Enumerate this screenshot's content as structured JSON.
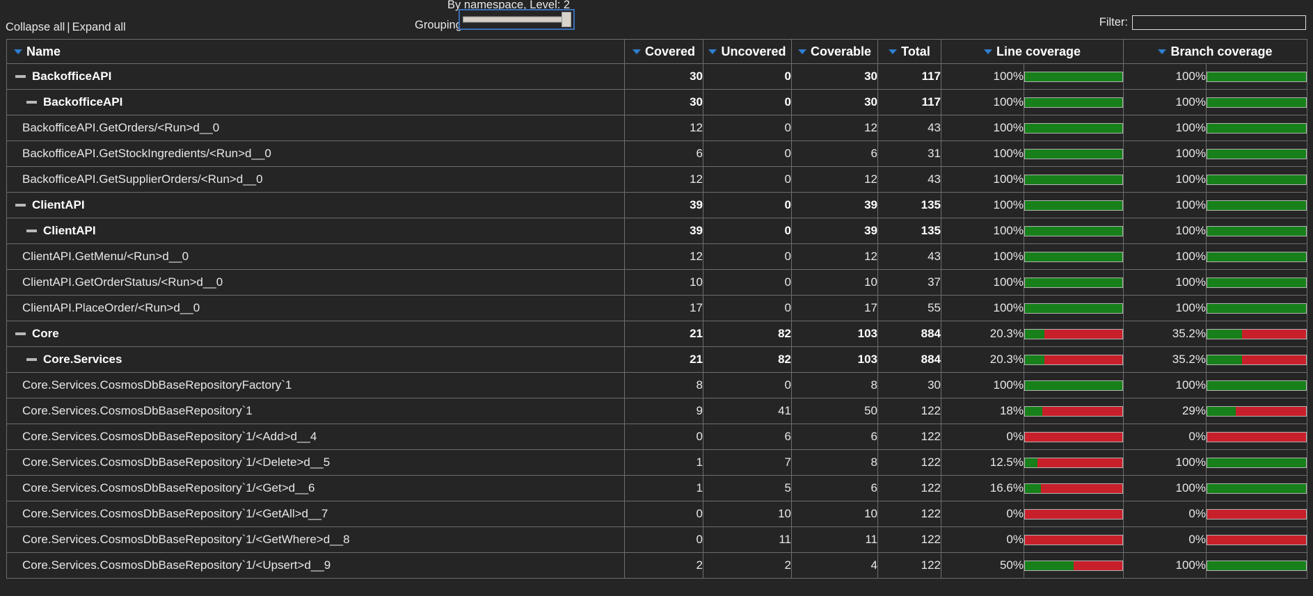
{
  "toolbar": {
    "collapse_all": "Collapse all",
    "separator": "|",
    "expand_all": "Expand all",
    "grouping_caption": "By namespace, Level: 2",
    "grouping_label": "Grouping:",
    "grouping_value": "2",
    "filter_label": "Filter:",
    "filter_value": "",
    "filter_placeholder": ""
  },
  "table": {
    "columns": [
      "Name",
      "Covered",
      "Uncovered",
      "Coverable",
      "Total",
      "Line coverage",
      "Branch coverage"
    ],
    "rows": [
      {
        "name": "BackofficeAPI",
        "level": 0,
        "bold": true,
        "expander": "minus",
        "covered": "30",
        "uncovered": "0",
        "coverable": "30",
        "total": "117",
        "line_pct": "100%",
        "line_val": 100,
        "branch_pct": "100%",
        "branch_val": 100
      },
      {
        "name": "BackofficeAPI",
        "level": 1,
        "bold": true,
        "expander": "minus",
        "covered": "30",
        "uncovered": "0",
        "coverable": "30",
        "total": "117",
        "line_pct": "100%",
        "line_val": 100,
        "branch_pct": "100%",
        "branch_val": 100
      },
      {
        "name": "BackofficeAPI.GetOrders/<Run>d__0",
        "level": 2,
        "bold": false,
        "expander": "none",
        "covered": "12",
        "uncovered": "0",
        "coverable": "12",
        "total": "43",
        "line_pct": "100%",
        "line_val": 100,
        "branch_pct": "100%",
        "branch_val": 100
      },
      {
        "name": "BackofficeAPI.GetStockIngredients/<Run>d__0",
        "level": 2,
        "bold": false,
        "expander": "none",
        "covered": "6",
        "uncovered": "0",
        "coverable": "6",
        "total": "31",
        "line_pct": "100%",
        "line_val": 100,
        "branch_pct": "100%",
        "branch_val": 100
      },
      {
        "name": "BackofficeAPI.GetSupplierOrders/<Run>d__0",
        "level": 2,
        "bold": false,
        "expander": "none",
        "covered": "12",
        "uncovered": "0",
        "coverable": "12",
        "total": "43",
        "line_pct": "100%",
        "line_val": 100,
        "branch_pct": "100%",
        "branch_val": 100
      },
      {
        "name": "ClientAPI",
        "level": 0,
        "bold": true,
        "expander": "minus",
        "covered": "39",
        "uncovered": "0",
        "coverable": "39",
        "total": "135",
        "line_pct": "100%",
        "line_val": 100,
        "branch_pct": "100%",
        "branch_val": 100
      },
      {
        "name": "ClientAPI",
        "level": 1,
        "bold": true,
        "expander": "minus",
        "covered": "39",
        "uncovered": "0",
        "coverable": "39",
        "total": "135",
        "line_pct": "100%",
        "line_val": 100,
        "branch_pct": "100%",
        "branch_val": 100
      },
      {
        "name": "ClientAPI.GetMenu/<Run>d__0",
        "level": 2,
        "bold": false,
        "expander": "none",
        "covered": "12",
        "uncovered": "0",
        "coverable": "12",
        "total": "43",
        "line_pct": "100%",
        "line_val": 100,
        "branch_pct": "100%",
        "branch_val": 100
      },
      {
        "name": "ClientAPI.GetOrderStatus/<Run>d__0",
        "level": 2,
        "bold": false,
        "expander": "none",
        "covered": "10",
        "uncovered": "0",
        "coverable": "10",
        "total": "37",
        "line_pct": "100%",
        "line_val": 100,
        "branch_pct": "100%",
        "branch_val": 100
      },
      {
        "name": "ClientAPI.PlaceOrder/<Run>d__0",
        "level": 2,
        "bold": false,
        "expander": "none",
        "covered": "17",
        "uncovered": "0",
        "coverable": "17",
        "total": "55",
        "line_pct": "100%",
        "line_val": 100,
        "branch_pct": "100%",
        "branch_val": 100
      },
      {
        "name": "Core",
        "level": 0,
        "bold": true,
        "expander": "minus",
        "covered": "21",
        "uncovered": "82",
        "coverable": "103",
        "total": "884",
        "line_pct": "20.3%",
        "line_val": 20.3,
        "branch_pct": "35.2%",
        "branch_val": 35.2
      },
      {
        "name": "Core.Services",
        "level": 1,
        "bold": true,
        "expander": "minus",
        "covered": "21",
        "uncovered": "82",
        "coverable": "103",
        "total": "884",
        "line_pct": "20.3%",
        "line_val": 20.3,
        "branch_pct": "35.2%",
        "branch_val": 35.2
      },
      {
        "name": "Core.Services.CosmosDbBaseRepositoryFactory`1",
        "level": 2,
        "bold": false,
        "expander": "none",
        "covered": "8",
        "uncovered": "0",
        "coverable": "8",
        "total": "30",
        "line_pct": "100%",
        "line_val": 100,
        "branch_pct": "100%",
        "branch_val": 100
      },
      {
        "name": "Core.Services.CosmosDbBaseRepository`1",
        "level": 2,
        "bold": false,
        "expander": "none",
        "covered": "9",
        "uncovered": "41",
        "coverable": "50",
        "total": "122",
        "line_pct": "18%",
        "line_val": 18,
        "branch_pct": "29%",
        "branch_val": 29
      },
      {
        "name": "Core.Services.CosmosDbBaseRepository`1/<Add>d__4",
        "level": 2,
        "bold": false,
        "expander": "none",
        "covered": "0",
        "uncovered": "6",
        "coverable": "6",
        "total": "122",
        "line_pct": "0%",
        "line_val": 0,
        "branch_pct": "0%",
        "branch_val": 0
      },
      {
        "name": "Core.Services.CosmosDbBaseRepository`1/<Delete>d__5",
        "level": 2,
        "bold": false,
        "expander": "none",
        "covered": "1",
        "uncovered": "7",
        "coverable": "8",
        "total": "122",
        "line_pct": "12.5%",
        "line_val": 12.5,
        "branch_pct": "100%",
        "branch_val": 100
      },
      {
        "name": "Core.Services.CosmosDbBaseRepository`1/<Get>d__6",
        "level": 2,
        "bold": false,
        "expander": "none",
        "covered": "1",
        "uncovered": "5",
        "coverable": "6",
        "total": "122",
        "line_pct": "16.6%",
        "line_val": 16.6,
        "branch_pct": "100%",
        "branch_val": 100
      },
      {
        "name": "Core.Services.CosmosDbBaseRepository`1/<GetAll>d__7",
        "level": 2,
        "bold": false,
        "expander": "none",
        "covered": "0",
        "uncovered": "10",
        "coverable": "10",
        "total": "122",
        "line_pct": "0%",
        "line_val": 0,
        "branch_pct": "0%",
        "branch_val": 0
      },
      {
        "name": "Core.Services.CosmosDbBaseRepository`1/<GetWhere>d__8",
        "level": 2,
        "bold": false,
        "expander": "none",
        "covered": "0",
        "uncovered": "11",
        "coverable": "11",
        "total": "122",
        "line_pct": "0%",
        "line_val": 0,
        "branch_pct": "0%",
        "branch_val": 0
      },
      {
        "name": "Core.Services.CosmosDbBaseRepository`1/<Upsert>d__9",
        "level": 2,
        "bold": false,
        "expander": "none",
        "covered": "2",
        "uncovered": "2",
        "coverable": "4",
        "total": "122",
        "line_pct": "50%",
        "line_val": 50,
        "branch_pct": "100%",
        "branch_val": 100
      }
    ]
  },
  "colors": {
    "background": "#252526",
    "covered_green": "#17801a",
    "uncovered_red": "#c8202a",
    "caret_blue": "#2f7fd0",
    "slider_border": "#3a6fb5",
    "grid_line": "#6e6e6e"
  }
}
